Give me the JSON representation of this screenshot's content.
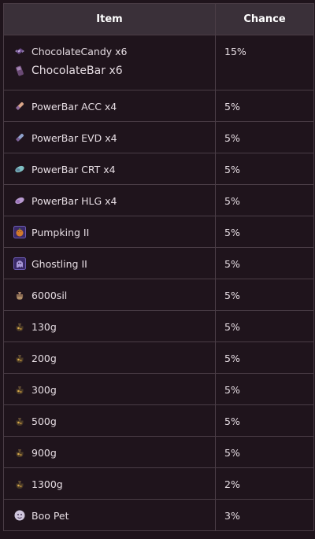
{
  "table": {
    "headers": {
      "item": "Item",
      "chance": "Chance"
    },
    "rows": [
      {
        "items": [
          {
            "name": "ChocolateCandy x6",
            "icon": "chocolate-candy-icon"
          },
          {
            "name": "ChocolateBar x6",
            "icon": "chocolate-bar-icon"
          }
        ],
        "chance": "15%"
      },
      {
        "items": [
          {
            "name": "PowerBar ACC x4",
            "icon": "powerbar-acc-icon"
          }
        ],
        "chance": "5%"
      },
      {
        "items": [
          {
            "name": "PowerBar EVD x4",
            "icon": "powerbar-evd-icon"
          }
        ],
        "chance": "5%"
      },
      {
        "items": [
          {
            "name": "PowerBar CRT x4",
            "icon": "powerbar-crt-icon"
          }
        ],
        "chance": "5%"
      },
      {
        "items": [
          {
            "name": "PowerBar HLG x4",
            "icon": "powerbar-hlg-icon"
          }
        ],
        "chance": "5%"
      },
      {
        "items": [
          {
            "name": "Pumpking II",
            "icon": "pumpking-icon"
          }
        ],
        "chance": "5%"
      },
      {
        "items": [
          {
            "name": "Ghostling II",
            "icon": "ghostling-icon"
          }
        ],
        "chance": "5%"
      },
      {
        "items": [
          {
            "name": "6000sil",
            "icon": "silver-bag-icon"
          }
        ],
        "chance": "5%"
      },
      {
        "items": [
          {
            "name": "130g",
            "icon": "gold-pouch-icon"
          }
        ],
        "chance": "5%"
      },
      {
        "items": [
          {
            "name": "200g",
            "icon": "gold-pouch-icon"
          }
        ],
        "chance": "5%"
      },
      {
        "items": [
          {
            "name": "300g",
            "icon": "gold-pouch-icon"
          }
        ],
        "chance": "5%"
      },
      {
        "items": [
          {
            "name": "500g",
            "icon": "gold-pouch-icon"
          }
        ],
        "chance": "5%"
      },
      {
        "items": [
          {
            "name": "900g",
            "icon": "gold-pouch-icon"
          }
        ],
        "chance": "5%"
      },
      {
        "items": [
          {
            "name": "1300g",
            "icon": "gold-pouch-icon"
          }
        ],
        "chance": "2%"
      },
      {
        "items": [
          {
            "name": "Boo Pet",
            "icon": "boo-pet-icon"
          }
        ],
        "chance": "3%"
      }
    ]
  },
  "colors": {
    "background": "#1f141c",
    "header_bg": "#3a3039",
    "border": "#4a3d46",
    "text": "#e6dde3"
  }
}
